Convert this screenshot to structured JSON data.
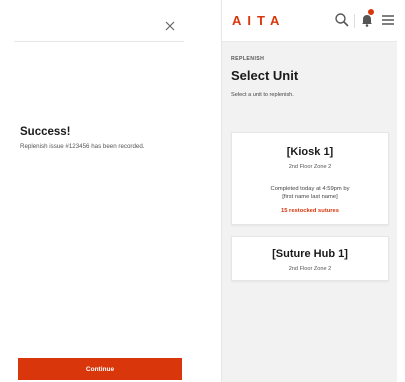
{
  "success_screen": {
    "title": "Success!",
    "message": "Replenish issue #123456 has been recorded.",
    "continue_label": "Continue",
    "icons": {
      "close": "close-icon"
    }
  },
  "select_screen": {
    "logo": "AITA",
    "header_icons": [
      "search-icon",
      "bell-icon",
      "menu-icon"
    ],
    "section_label": "REPLENISH",
    "title": "Select Unit",
    "subtitle": "Select a unit to replenish.",
    "units": [
      {
        "name": "[Kiosk 1]",
        "location": "2nd Floor Zone 2",
        "completed_line1": "Completed today at 4:59pm by",
        "completed_line2": "[first name last name]",
        "link": "15 restocked sutures"
      },
      {
        "name": "[Suture Hub 1]",
        "location": "2nd Floor Zone 2"
      }
    ]
  },
  "colors": {
    "accent": "#d9360b",
    "background": "#f2f2f2",
    "card": "#ffffff"
  }
}
